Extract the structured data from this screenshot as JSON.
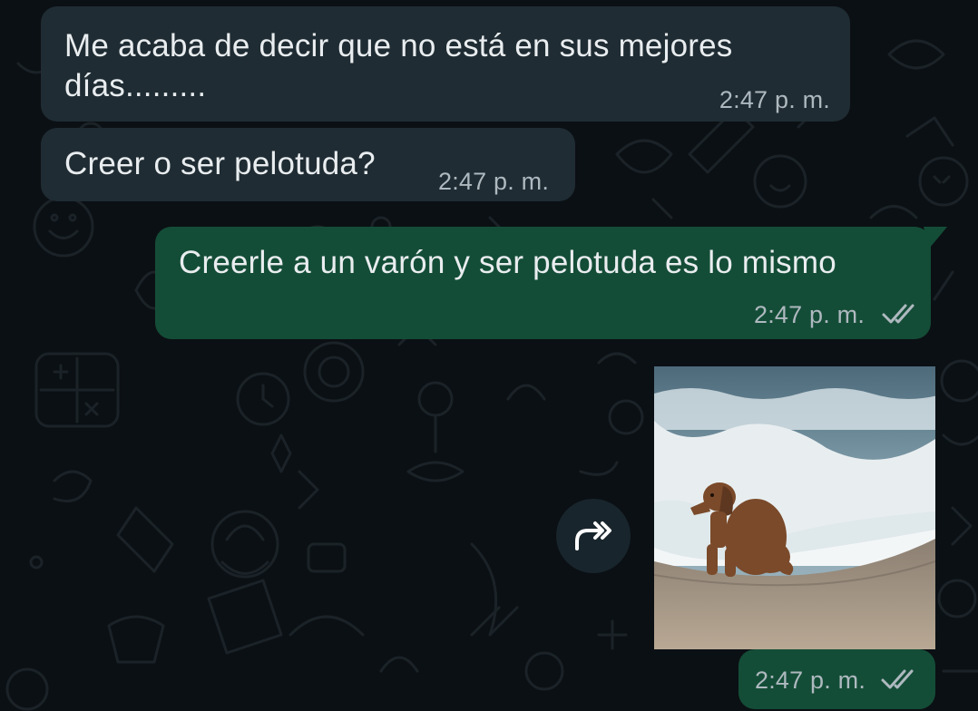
{
  "colors": {
    "background": "#0b1014",
    "incoming_bubble": "#1f2c33",
    "outgoing_bubble": "#144d37",
    "text": "#e9edef",
    "timestamp": "#aeb9bf"
  },
  "messages": [
    {
      "direction": "incoming",
      "lines": [
        "Me acaba de decir que no está en sus mejores",
        "días........."
      ],
      "time": "2:47 p. m."
    },
    {
      "direction": "incoming",
      "text": "Creer o ser pelotuda?",
      "time": "2:47 p. m."
    },
    {
      "direction": "outgoing",
      "text": "Creerle a un varón y ser pelotuda es lo mismo",
      "time": "2:47 p. m.",
      "status": "read-ticks-icon"
    },
    {
      "direction": "outgoing",
      "type": "image",
      "image_content": "dog sitting on beach by waves",
      "time": "2:47 p. m.",
      "status": "read-ticks-icon"
    }
  ],
  "icons": {
    "forward": "forward-icon",
    "read_status": "read-ticks-icon"
  }
}
